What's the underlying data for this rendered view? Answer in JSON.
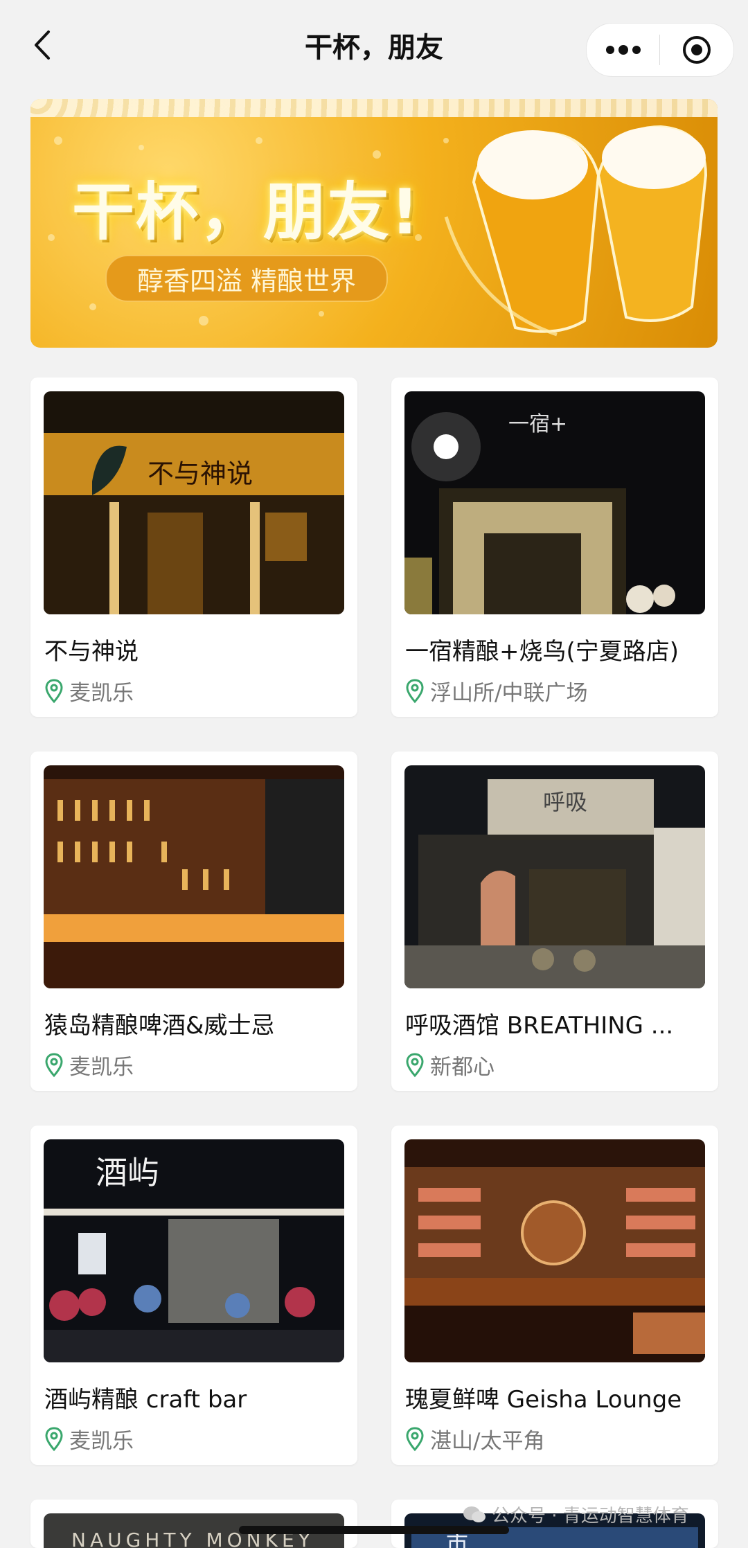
{
  "navbar": {
    "title": "干杯，朋友"
  },
  "banner": {
    "headline": "干杯，朋友!",
    "subtitle": "醇香四溢 精酿世界"
  },
  "venues": [
    {
      "name": "不与神说",
      "location": "麦凯乐"
    },
    {
      "name": "一宿精酿+烧鸟(宁夏路店)",
      "location": "浮山所/中联广场"
    },
    {
      "name": "猿岛精酿啤酒&威士忌",
      "location": "麦凯乐"
    },
    {
      "name": "呼吸酒馆 BREATHING ...",
      "location": "新都心"
    },
    {
      "name": "酒屿精酿 craft bar",
      "location": "麦凯乐"
    },
    {
      "name": "瑰夏鲜啤 Geisha Lounge",
      "location": "湛山/太平角"
    }
  ],
  "photo_signs": {
    "v1": "不与神说",
    "v2": "一宿+",
    "v4": "呼吸",
    "v5": "酒屿",
    "v7": "NAUGHTY MONKEY",
    "v8": "市"
  },
  "watermark": "公众号 · 青运动智慧体育",
  "colors": {
    "pin": "#3aa76d",
    "banner_gold": "#f4b11d"
  }
}
